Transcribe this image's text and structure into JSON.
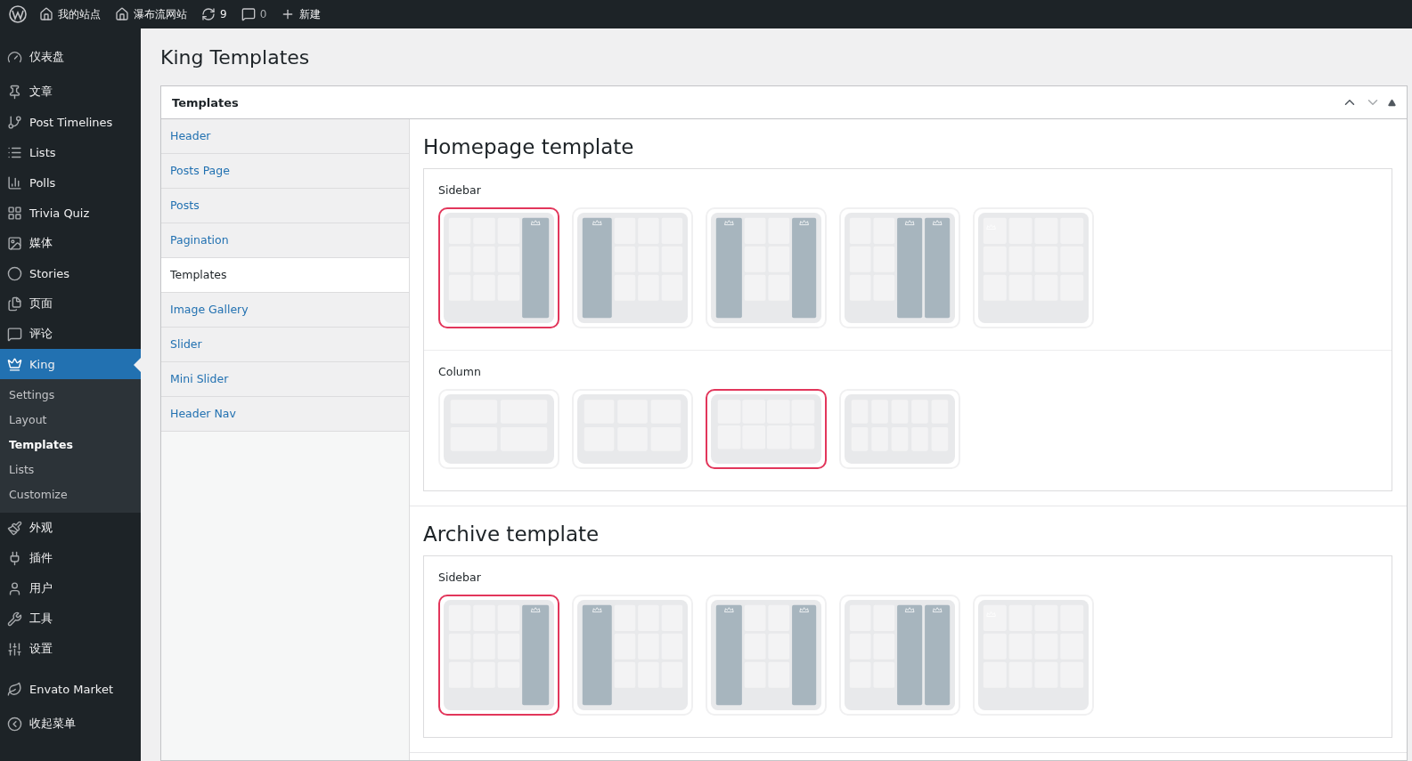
{
  "admin_bar": {
    "items": [
      {
        "label": "我的站点"
      },
      {
        "label": "瀑布流网站"
      },
      {
        "label": "9"
      },
      {
        "label": "0"
      },
      {
        "label": "新建"
      }
    ]
  },
  "menu": {
    "items": [
      {
        "label": "仪表盘",
        "current": false
      },
      {
        "label": "文章",
        "current": false
      },
      {
        "label": "Post Timelines",
        "current": false
      },
      {
        "label": "Lists",
        "current": false
      },
      {
        "label": "Polls",
        "current": false
      },
      {
        "label": "Trivia Quiz",
        "current": false
      },
      {
        "label": "媒体",
        "current": false
      },
      {
        "label": "Stories",
        "current": false
      },
      {
        "label": "页面",
        "current": false
      },
      {
        "label": "评论",
        "current": false
      },
      {
        "label": "King",
        "current": true,
        "submenu": [
          {
            "label": "Settings",
            "selected": false
          },
          {
            "label": "Layout",
            "selected": false
          },
          {
            "label": "Templates",
            "selected": true
          },
          {
            "label": "Lists",
            "selected": false
          },
          {
            "label": "Customize",
            "selected": false
          }
        ]
      },
      {
        "label": "外观",
        "current": false
      },
      {
        "label": "插件",
        "current": false
      },
      {
        "label": "用户",
        "current": false
      },
      {
        "label": "工具",
        "current": false
      },
      {
        "label": "设置",
        "current": false
      },
      {
        "label": "Envato Market",
        "current": false
      },
      {
        "label": "收起菜单",
        "current": false
      }
    ]
  },
  "page": {
    "title": "King Templates"
  },
  "panel": {
    "title": "Templates",
    "tabs": [
      {
        "label": "Header",
        "selected": false
      },
      {
        "label": "Posts Page",
        "selected": false
      },
      {
        "label": "Posts",
        "selected": false
      },
      {
        "label": "Pagination",
        "selected": false
      },
      {
        "label": "Templates",
        "selected": true
      },
      {
        "label": "Image Gallery",
        "selected": false
      },
      {
        "label": "Slider",
        "selected": false
      },
      {
        "label": "Mini Slider",
        "selected": false
      },
      {
        "label": "Header Nav",
        "selected": false
      }
    ],
    "sections": [
      {
        "title": "Homepage template",
        "groups": [
          {
            "label": "Sidebar",
            "options": [
              {
                "kind": "right",
                "selected": true
              },
              {
                "kind": "left",
                "selected": false
              },
              {
                "kind": "both",
                "selected": false
              },
              {
                "kind": "double",
                "selected": false
              },
              {
                "kind": "none",
                "selected": false
              }
            ]
          },
          {
            "label": "Column",
            "options": [
              {
                "kind": "two",
                "selected": false
              },
              {
                "kind": "three",
                "selected": false
              },
              {
                "kind": "four",
                "selected": true
              },
              {
                "kind": "five",
                "selected": false
              }
            ]
          }
        ]
      },
      {
        "title": "Archive template",
        "groups": [
          {
            "label": "Sidebar",
            "options": [
              {
                "kind": "right",
                "selected": true
              },
              {
                "kind": "left",
                "selected": false
              },
              {
                "kind": "both",
                "selected": false
              },
              {
                "kind": "double",
                "selected": false
              },
              {
                "kind": "none",
                "selected": false
              }
            ]
          }
        ]
      }
    ]
  }
}
